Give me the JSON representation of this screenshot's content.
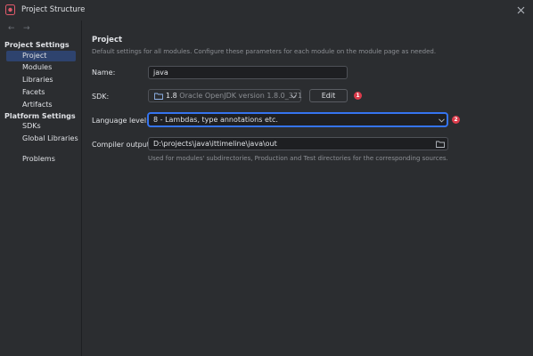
{
  "window": {
    "title": "Project Structure"
  },
  "sidebar": {
    "groups": [
      {
        "label": "Project Settings",
        "items": [
          "Project",
          "Modules",
          "Libraries",
          "Facets",
          "Artifacts"
        ]
      },
      {
        "label": "Platform Settings",
        "items": [
          "SDKs",
          "Global Libraries"
        ]
      }
    ],
    "extra_item": "Problems",
    "selected_item": "Project"
  },
  "main": {
    "section_title": "Project",
    "section_desc": "Default settings for all modules. Configure these parameters for each module on the module page as needed.",
    "name": {
      "label": "Name:",
      "value": "java"
    },
    "sdk": {
      "label": "SDK:",
      "version": "1.8",
      "description": "Oracle OpenJDK version 1.8.0_371",
      "edit_label": "Edit",
      "badge": "1"
    },
    "language_level": {
      "label": "Language level:",
      "value": "8 - Lambdas, type annotations etc.",
      "badge": "2"
    },
    "compiler_output": {
      "label": "Compiler output:",
      "value": "D:\\projects\\java\\ittimeline\\java\\out",
      "hint": "Used for modules' subdirectories, Production and Test directories for the corresponding sources."
    }
  },
  "colors": {
    "accent": "#3574f0",
    "selection": "#2e436e",
    "badge": "#db3b4b",
    "background": "#2b2d30",
    "field": "#1e1f22"
  },
  "icons": [
    "app-icon",
    "close-icon",
    "back-arrow-icon",
    "forward-arrow-icon",
    "folder-icon",
    "chevron-down-icon"
  ]
}
